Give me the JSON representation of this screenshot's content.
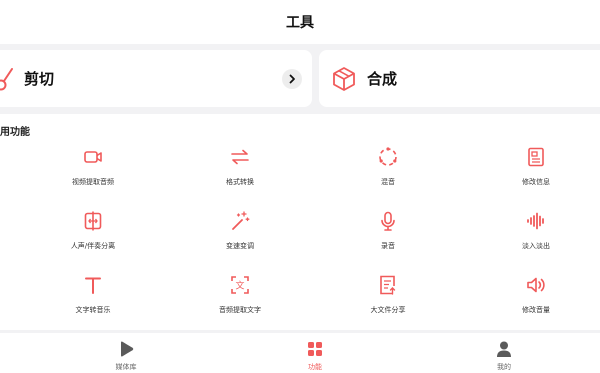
{
  "header": {
    "title": "工具"
  },
  "cards": {
    "cut": {
      "label": "剪切",
      "icon": "scissors-icon",
      "arrow_icon": "chevron-right-icon"
    },
    "merge": {
      "label": "合成",
      "icon": "cube-icon"
    }
  },
  "section": {
    "title": "用功能"
  },
  "tools": [
    {
      "label": "视频提取音频",
      "icon": "video-camera-icon"
    },
    {
      "label": "格式转换",
      "icon": "swap-arrows-icon"
    },
    {
      "label": "混音",
      "icon": "mix-circle-icon"
    },
    {
      "label": "修改信息",
      "icon": "info-card-icon"
    },
    {
      "label": "人声/伴奏分离",
      "icon": "separate-icon"
    },
    {
      "label": "变速变调",
      "icon": "magic-wand-icon"
    },
    {
      "label": "录音",
      "icon": "microphone-icon"
    },
    {
      "label": "淡入淡出",
      "icon": "waveform-icon"
    },
    {
      "label": "文字转音乐",
      "icon": "text-t-icon"
    },
    {
      "label": "音频提取文字",
      "icon": "text-scan-icon"
    },
    {
      "label": "大文件分享",
      "icon": "file-share-icon"
    },
    {
      "label": "修改音量",
      "icon": "volume-icon"
    }
  ],
  "tabbar": {
    "items": [
      {
        "label": "媒体库",
        "icon": "media-play-icon"
      },
      {
        "label": "功能",
        "icon": "grid-icon",
        "active": true
      },
      {
        "label": "我的",
        "icon": "user-icon"
      }
    ]
  },
  "colors": {
    "accent": "#f05a5a",
    "inactive": "#5a5a5a",
    "background": "#f2f2f4"
  }
}
